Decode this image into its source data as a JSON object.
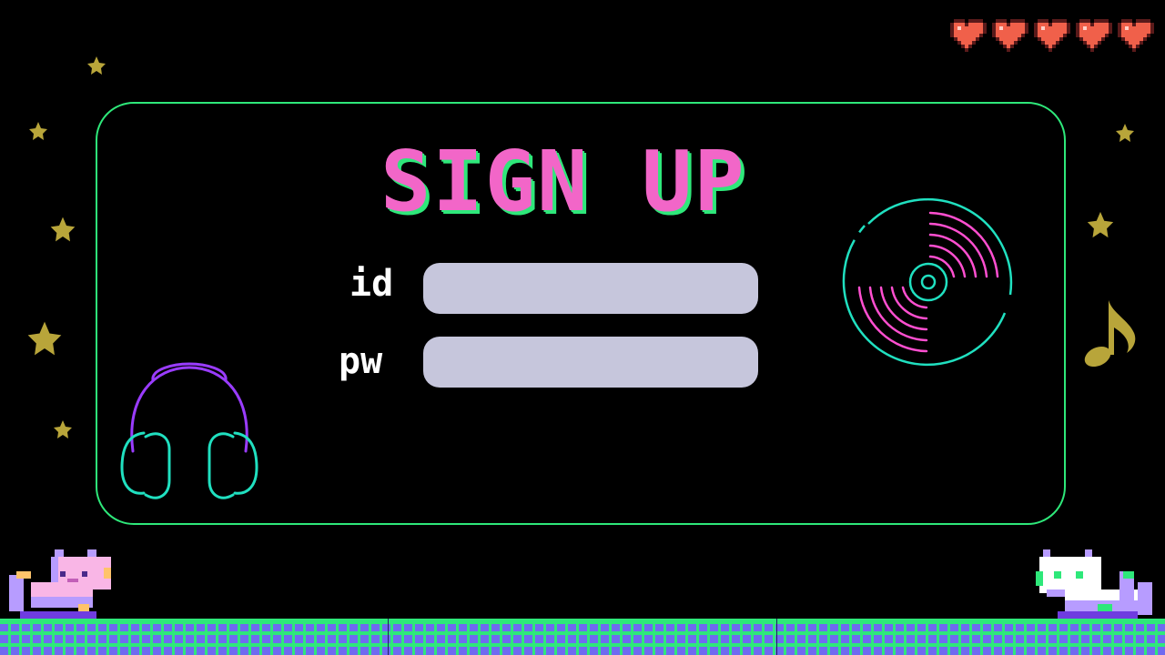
{
  "screen": {
    "title": "SIGN UP",
    "lives": 5
  },
  "form": {
    "id_label": "id",
    "pw_label": "pw",
    "id_value": "",
    "pw_value": ""
  },
  "icons": {
    "heart": "heart-icon",
    "headphones": "headphones-icon",
    "vinyl": "vinyl-record-icon",
    "music_note": "music-note-icon",
    "star": "star-icon",
    "cat_left": "pink-cat-sprite",
    "cat_right": "white-cat-sprite"
  },
  "colors": {
    "background": "#000000",
    "panel_border": "#2ee87a",
    "title": "#f266c8",
    "title_shadow": "#2ee87a",
    "input_bg": "#c6c6dc",
    "heart": "#f0604a",
    "star": "#b8a53a",
    "headphones_band": "#9a3cff",
    "headphones_cups": "#20e0c0",
    "vinyl_ring": "#20e0c0",
    "vinyl_grooves": "#ff4fd0",
    "ground_grass": "#2ee87a",
    "ground_brick": "#6f6af0"
  }
}
